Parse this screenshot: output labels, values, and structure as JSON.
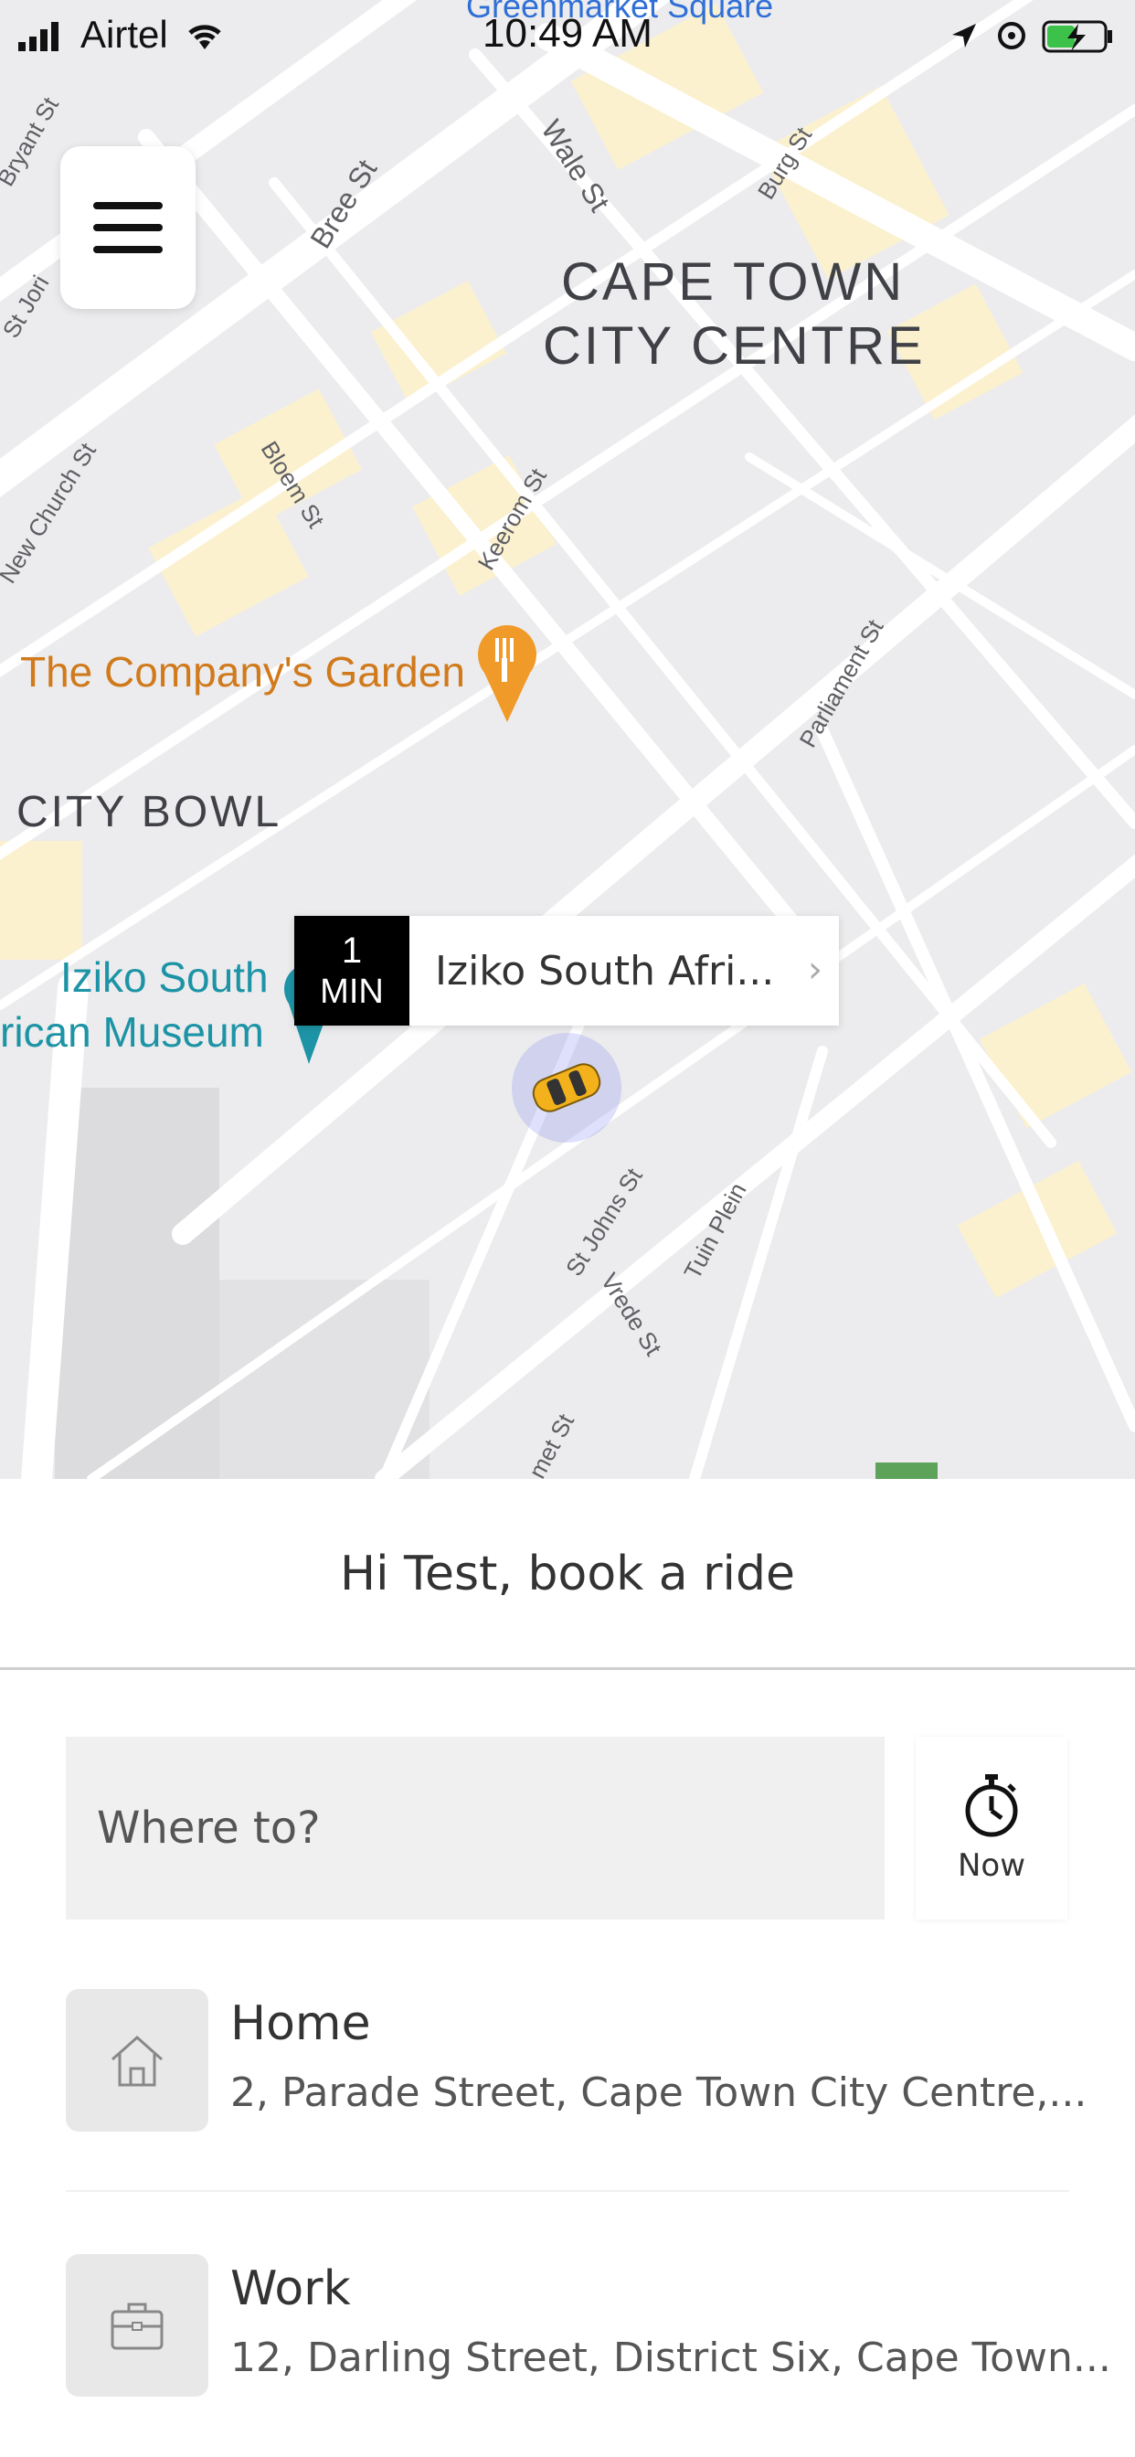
{
  "status_bar": {
    "carrier": "Airtel",
    "time": "10:49 AM"
  },
  "map": {
    "areas": {
      "cape_town_line1": "CAPE TOWN",
      "cape_town_line2": "CITY CENTRE",
      "city_bowl": "CITY BOWL"
    },
    "streets": {
      "bryant": "Bryant St",
      "jori": "St Jori",
      "bree": "Bree St",
      "wale": "Wale St",
      "burg": "Burg St",
      "new_church": "New Church St",
      "bloem": "Bloem St",
      "keerom": "Keerom St",
      "parliament": "Parliament St",
      "st_johns": "St Johns St",
      "vrede": "Vrede St",
      "tuin_plein": "Tuin Plein",
      "met": "met St",
      "greenmarket": "Greenmarket Square"
    },
    "pois": {
      "company_garden": "The Company's Garden",
      "iziko_line1": "Iziko South",
      "iziko_line2": "rican Museum"
    },
    "eta": {
      "number": "1",
      "unit": "MIN",
      "destination": "Iziko South Afri..."
    }
  },
  "sheet": {
    "greeting": "Hi Test, book a ride",
    "where_placeholder": "Where to?",
    "now_label": "Now",
    "saved_places": [
      {
        "name": "Home",
        "address": "2, Parade Street, Cape Town City Centre,...",
        "icon": "home-icon"
      },
      {
        "name": "Work",
        "address": "12, Darling Street, District Six, Cape Town...",
        "icon": "briefcase-icon"
      }
    ]
  },
  "colors": {
    "poi_orange": "#d07a1c",
    "poi_teal": "#1d94a6",
    "block_yellow": "#fbf1cf",
    "map_bg": "#ececee"
  }
}
